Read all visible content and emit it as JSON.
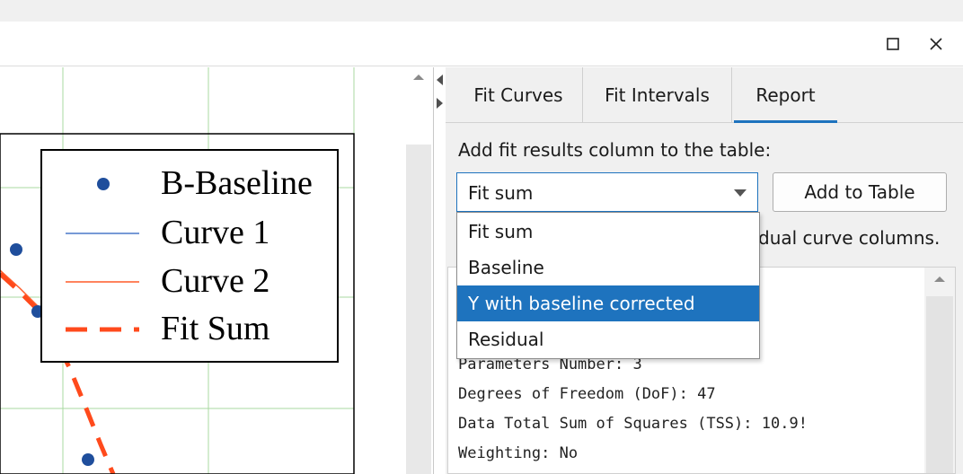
{
  "window": {
    "maximize_icon": "maximize-icon",
    "close_icon": "close-icon"
  },
  "plot": {
    "legend": [
      {
        "label": "B-Baseline",
        "style": "dot",
        "color": "#1f4e9c"
      },
      {
        "label": "Curve 1",
        "style": "line",
        "color": "#4a78c8"
      },
      {
        "label": "Curve 2",
        "style": "line",
        "color": "#ff5a28"
      },
      {
        "label": "Fit Sum",
        "style": "dash",
        "color": "#ff4a1c"
      }
    ],
    "grid_color": "#a8d8a0"
  },
  "tabs": [
    {
      "label": "Fit Curves",
      "active": false
    },
    {
      "label": "Fit Intervals",
      "active": false
    },
    {
      "label": "Report",
      "active": true
    }
  ],
  "report_panel": {
    "instruction": "Add fit results column to the table:",
    "selected": "Fit sum",
    "add_button": "Add to Table",
    "hint": "dual curve columns.",
    "options": [
      "Fit sum",
      "Baseline",
      "Y with baseline corrected",
      "Residual"
    ],
    "highlighted_option": "Y with baseline corrected",
    "report_lines": [
      "Parameters Number: 3",
      "Degrees of Freedom (DoF): 47",
      "Data Total Sum of Squares (TSS): 10.9!",
      "Weighting: No"
    ]
  },
  "colors": {
    "accent": "#1e73be"
  }
}
